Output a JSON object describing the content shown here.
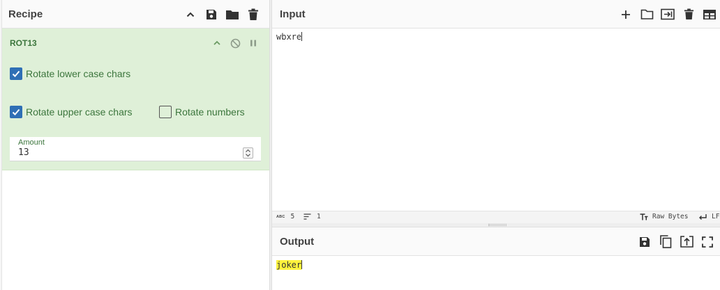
{
  "recipe": {
    "title": "Recipe",
    "icons": [
      "chevron-up-icon",
      "save-icon",
      "folder-icon",
      "trash-icon"
    ]
  },
  "operation": {
    "name": "ROT13",
    "options": {
      "rotate_lower": {
        "label": "Rotate lower case chars",
        "checked": true
      },
      "rotate_upper": {
        "label": "Rotate upper case chars",
        "checked": true
      },
      "rotate_numbers": {
        "label": "Rotate numbers",
        "checked": false
      }
    },
    "amount": {
      "label": "Amount",
      "value": "13"
    }
  },
  "input": {
    "title": "Input",
    "text": "wbxre",
    "icons": [
      "plus-icon",
      "folder-icon",
      "import-icon",
      "trash-icon",
      "layout-icon"
    ],
    "status": {
      "length_badge": "ABC",
      "length": "5",
      "lines": "1",
      "encoding": "Raw Bytes",
      "eol": "LF"
    }
  },
  "output": {
    "title": "Output",
    "text": "joker",
    "icons": [
      "save-icon",
      "copy-icon",
      "replace-input-icon",
      "maximize-icon"
    ]
  },
  "colors": {
    "op_background": "#dff0d8",
    "op_text": "#3c763d",
    "checkbox": "#2f6fb5",
    "highlight": "#fff23d"
  }
}
